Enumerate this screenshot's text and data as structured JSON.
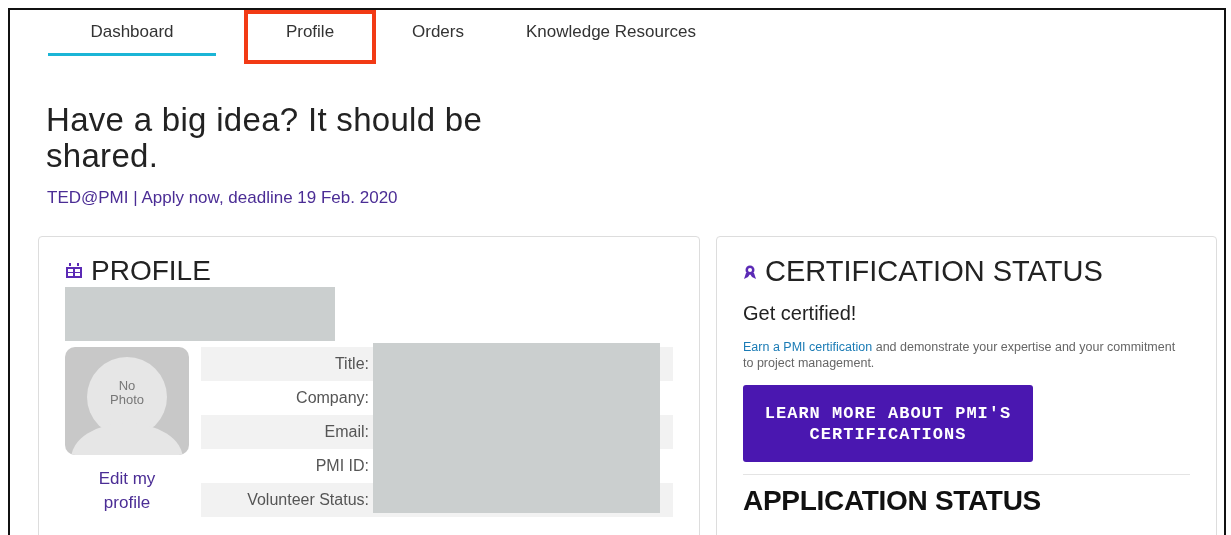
{
  "tabs": [
    {
      "label": "Dashboard",
      "selected": true,
      "highlighted": false
    },
    {
      "label": "Profile",
      "selected": false,
      "highlighted": true
    },
    {
      "label": "Orders",
      "selected": false,
      "highlighted": false
    },
    {
      "label": "Knowledge Resources",
      "selected": false,
      "highlighted": false
    }
  ],
  "headline": "Have a big idea? It should be shared.",
  "promo_link": "TED@PMI | Apply now, deadline 19 Feb. 2020",
  "profile": {
    "title": "PROFILE",
    "photo_placeholder": "No Photo",
    "edit_link": "Edit my profile",
    "fields": [
      {
        "label": "Title:"
      },
      {
        "label": "Company:"
      },
      {
        "label": "Email:"
      },
      {
        "label": "PMI ID:"
      },
      {
        "label": "Volunteer Status:"
      }
    ]
  },
  "certification": {
    "title": "CERTIFICATION STATUS",
    "subtitle": "Get certified!",
    "link": "Earn a PMI certification",
    "text": " and demonstrate your expertise and your commitment to project management.",
    "button": "LEARN MORE ABOUT PMI'S CERTIFICATIONS"
  },
  "application": {
    "title": "APPLICATION STATUS"
  }
}
